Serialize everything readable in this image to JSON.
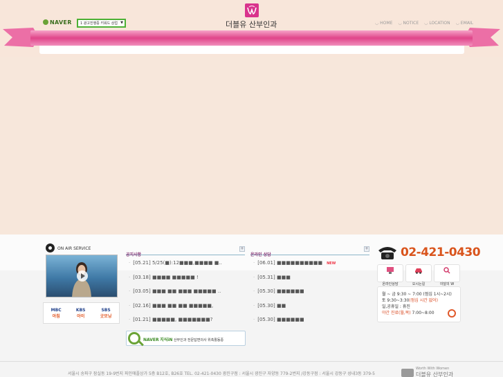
{
  "header": {
    "naver_label": "NAVER",
    "ad_keyword_select": "1 광고진행중 키워드 상업",
    "site_title": "더블유 산부인과",
    "nav": [
      "HOME",
      "NOTICE",
      "LOCATION",
      "EMAIL"
    ]
  },
  "onair": {
    "title": "ON AIR SERVICE",
    "channels": [
      {
        "net": "MBC",
        "show": "아침"
      },
      {
        "net": "KBS",
        "show": "아이"
      },
      {
        "net": "SBS",
        "show": "굿모닝"
      }
    ]
  },
  "notice": {
    "title": "공지사항",
    "plus": "+",
    "items": [
      "[05.21] 5/25(■):12■■■,■■■■ ■..",
      "[03.18] ■■■■ ■■■■■ !",
      "[03.05] ■■■ ■■ ■■■ ■■■■■ ..",
      "[02.16] ■■■ ■■ ■■ ■■■■■,",
      "[01.21] ■■■■■, ■■■■■■■?"
    ]
  },
  "online": {
    "title": "온라인 상담",
    "plus": "+",
    "new_badge": "NEW",
    "items": [
      "[06.01] ■■■■■■■■■■",
      "[05.31] ■■■",
      "[05.30] ■■■■■■",
      "[05.30] ■■",
      "[05.30] ■■■■■■"
    ]
  },
  "naver_kin": {
    "brand": "NAVER",
    "kin": "지식iN",
    "text": "산부인과 전문답변의사 위촉활동중"
  },
  "contact": {
    "phone": "02-421-0430",
    "quick": [
      "온라인상담",
      "오시는길",
      "이달의 W"
    ],
    "hours_line1": "월 ~ 금 9:30 ~ 7:00 (점심 1시~2시)",
    "hours_line2_a": "토 9:30~3:30",
    "hours_line2_b": "(점심 시간 없어)",
    "hours_line3": "일,공휴일 : 휴진",
    "night_a": "야간 진료",
    "night_b": "(월,목)",
    "night_c": " 7:00~8:00"
  },
  "footer": {
    "address": "서울시 송파구 잠실동 19-9번지 파인애플상가 5층 B12호, B26호   TEL. 02-421-0430   광진구점 : 서울시 광진구 자양동 779-2번지 /강동구점 : 서울시 강동구 성내3동 379-5",
    "logo_small": "Worth With Women",
    "logo_big": "더블유 산부인과"
  },
  "colors": {
    "background": "#f7e7db",
    "accent_pink": "#e0468a",
    "phone_orange": "#d9541c",
    "naver_green": "#4cb034"
  }
}
